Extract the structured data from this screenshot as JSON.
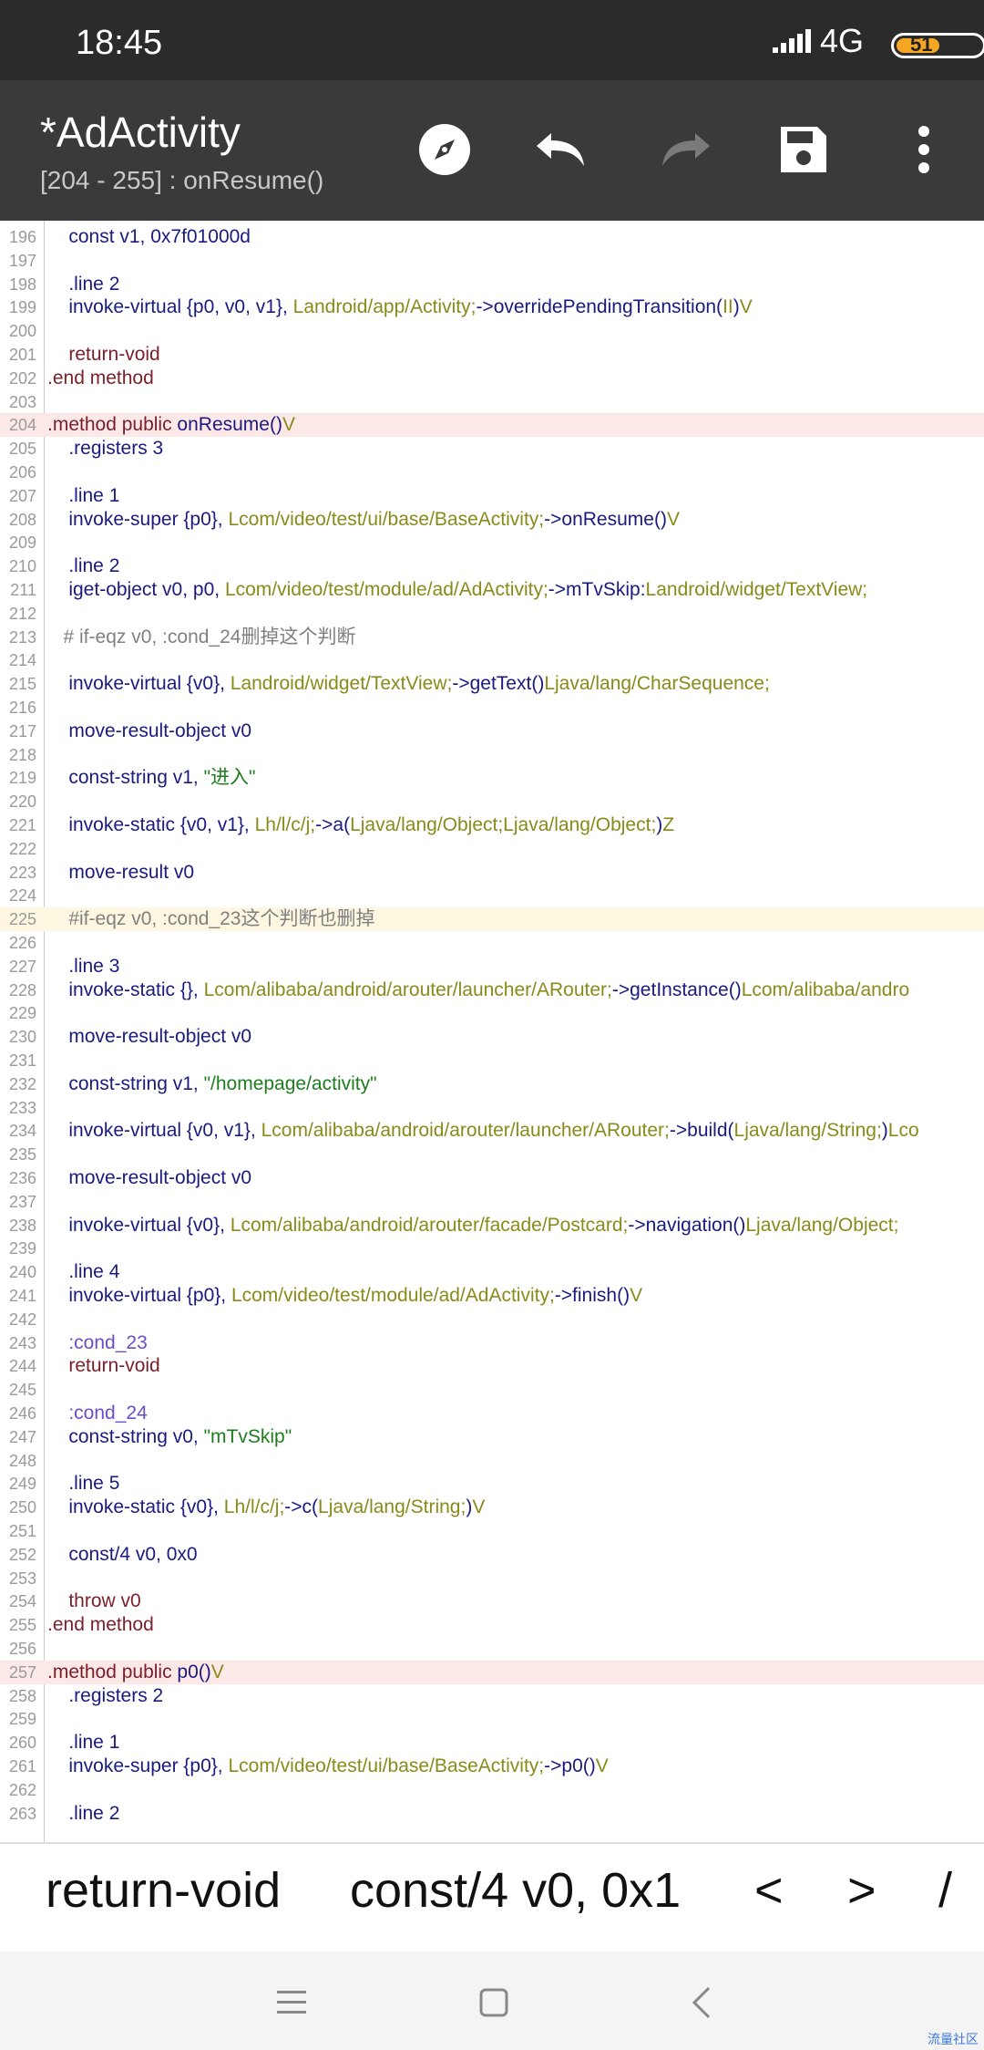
{
  "status_bar": {
    "time": "18:45",
    "network": "4G",
    "battery": "51",
    "battery_level": 0.51
  },
  "app_bar": {
    "title": "*AdActivity",
    "subtitle": "[204 - 255] : onResume()"
  },
  "editor": {
    "lines": [
      {
        "n": "196",
        "h": "",
        "parts": [
          [
            "",
            "    const v1, 0x7f01000d"
          ]
        ]
      },
      {
        "n": "197",
        "h": "",
        "parts": []
      },
      {
        "n": "198",
        "h": "",
        "parts": [
          [
            "",
            "    .line 2"
          ]
        ]
      },
      {
        "n": "199",
        "h": "",
        "parts": [
          [
            "",
            "    invoke-virtual {p0, v0, v1}, "
          ],
          [
            "ref",
            "Landroid/app/Activity;"
          ],
          [
            "",
            "->overridePendingTransition("
          ],
          [
            "ref",
            "II"
          ],
          [
            "",
            ")"
          ],
          [
            "ref",
            "V"
          ]
        ]
      },
      {
        "n": "200",
        "h": "",
        "parts": []
      },
      {
        "n": "201",
        "h": "",
        "parts": [
          [
            "kw",
            "    return-void"
          ]
        ]
      },
      {
        "n": "202",
        "h": "",
        "parts": [
          [
            "kw",
            ".end method"
          ]
        ]
      },
      {
        "n": "203",
        "h": "",
        "parts": []
      },
      {
        "n": "204",
        "h": "red",
        "parts": [
          [
            "kw",
            ".method public "
          ],
          [
            "",
            "onResume()"
          ],
          [
            "ref",
            "V"
          ]
        ]
      },
      {
        "n": "205",
        "h": "",
        "parts": [
          [
            "",
            "    .registers 3"
          ]
        ]
      },
      {
        "n": "206",
        "h": "",
        "parts": []
      },
      {
        "n": "207",
        "h": "",
        "parts": [
          [
            "",
            "    .line 1"
          ]
        ]
      },
      {
        "n": "208",
        "h": "",
        "parts": [
          [
            "",
            "    invoke-super {p0}, "
          ],
          [
            "ref",
            "Lcom/video/test/ui/base/BaseActivity;"
          ],
          [
            "",
            "->onResume()"
          ],
          [
            "ref",
            "V"
          ]
        ]
      },
      {
        "n": "209",
        "h": "",
        "parts": []
      },
      {
        "n": "210",
        "h": "",
        "parts": [
          [
            "",
            "    .line 2"
          ]
        ]
      },
      {
        "n": "211",
        "h": "",
        "parts": [
          [
            "",
            "    iget-object v0, p0, "
          ],
          [
            "ref",
            "Lcom/video/test/module/ad/AdActivity;"
          ],
          [
            "",
            "->mTvSkip:"
          ],
          [
            "ref",
            "Landroid/widget/TextView;"
          ]
        ]
      },
      {
        "n": "212",
        "h": "",
        "parts": []
      },
      {
        "n": "213",
        "h": "",
        "parts": [
          [
            "cm",
            "   # if-eqz v0, :cond_24删掉这个判断"
          ]
        ]
      },
      {
        "n": "214",
        "h": "",
        "parts": []
      },
      {
        "n": "215",
        "h": "",
        "parts": [
          [
            "",
            "    invoke-virtual {v0}, "
          ],
          [
            "ref",
            "Landroid/widget/TextView;"
          ],
          [
            "",
            "->getText()"
          ],
          [
            "ref",
            "Ljava/lang/CharSequence;"
          ]
        ]
      },
      {
        "n": "216",
        "h": "",
        "parts": []
      },
      {
        "n": "217",
        "h": "",
        "parts": [
          [
            "",
            "    move-result-object v0"
          ]
        ]
      },
      {
        "n": "218",
        "h": "",
        "parts": []
      },
      {
        "n": "219",
        "h": "",
        "parts": [
          [
            "",
            "    const-string v1, "
          ],
          [
            "str",
            "\"进入\""
          ]
        ]
      },
      {
        "n": "220",
        "h": "",
        "parts": []
      },
      {
        "n": "221",
        "h": "",
        "parts": [
          [
            "",
            "    invoke-static {v0, v1}, "
          ],
          [
            "ref",
            "Lh/l/c/j;"
          ],
          [
            "",
            "->a("
          ],
          [
            "ref",
            "Ljava/lang/Object;Ljava/lang/Object;"
          ],
          [
            "",
            ")"
          ],
          [
            "ref",
            "Z"
          ]
        ]
      },
      {
        "n": "222",
        "h": "",
        "parts": []
      },
      {
        "n": "223",
        "h": "",
        "parts": [
          [
            "",
            "    move-result v0"
          ]
        ]
      },
      {
        "n": "224",
        "h": "",
        "parts": []
      },
      {
        "n": "225",
        "h": "yellow",
        "parts": [
          [
            "cm",
            "    #if-eqz v0, :cond_23这个判断也删掉"
          ]
        ]
      },
      {
        "n": "226",
        "h": "",
        "parts": []
      },
      {
        "n": "227",
        "h": "",
        "parts": [
          [
            "",
            "    .line 3"
          ]
        ]
      },
      {
        "n": "228",
        "h": "",
        "parts": [
          [
            "",
            "    invoke-static {}, "
          ],
          [
            "ref",
            "Lcom/alibaba/android/arouter/launcher/ARouter;"
          ],
          [
            "",
            "->getInstance()"
          ],
          [
            "ref",
            "Lcom/alibaba/andro"
          ]
        ]
      },
      {
        "n": "229",
        "h": "",
        "parts": []
      },
      {
        "n": "230",
        "h": "",
        "parts": [
          [
            "",
            "    move-result-object v0"
          ]
        ]
      },
      {
        "n": "231",
        "h": "",
        "parts": []
      },
      {
        "n": "232",
        "h": "",
        "parts": [
          [
            "",
            "    const-string v1, "
          ],
          [
            "str",
            "\"/homepage/activity\""
          ]
        ]
      },
      {
        "n": "233",
        "h": "",
        "parts": []
      },
      {
        "n": "234",
        "h": "",
        "parts": [
          [
            "",
            "    invoke-virtual {v0, v1}, "
          ],
          [
            "ref",
            "Lcom/alibaba/android/arouter/launcher/ARouter;"
          ],
          [
            "",
            "->build("
          ],
          [
            "ref",
            "Ljava/lang/String;"
          ],
          [
            "",
            ")"
          ],
          [
            "ref",
            "Lco"
          ]
        ]
      },
      {
        "n": "235",
        "h": "",
        "parts": []
      },
      {
        "n": "236",
        "h": "",
        "parts": [
          [
            "",
            "    move-result-object v0"
          ]
        ]
      },
      {
        "n": "237",
        "h": "",
        "parts": []
      },
      {
        "n": "238",
        "h": "",
        "parts": [
          [
            "",
            "    invoke-virtual {v0}, "
          ],
          [
            "ref",
            "Lcom/alibaba/android/arouter/facade/Postcard;"
          ],
          [
            "",
            "->navigation()"
          ],
          [
            "ref",
            "Ljava/lang/Object;"
          ]
        ]
      },
      {
        "n": "239",
        "h": "",
        "parts": []
      },
      {
        "n": "240",
        "h": "",
        "parts": [
          [
            "",
            "    .line 4"
          ]
        ]
      },
      {
        "n": "241",
        "h": "",
        "parts": [
          [
            "",
            "    invoke-virtual {p0}, "
          ],
          [
            "ref",
            "Lcom/video/test/module/ad/AdActivity;"
          ],
          [
            "",
            "->finish()"
          ],
          [
            "ref",
            "V"
          ]
        ]
      },
      {
        "n": "242",
        "h": "",
        "parts": []
      },
      {
        "n": "243",
        "h": "",
        "parts": [
          [
            "lbl",
            "    :cond_23"
          ]
        ]
      },
      {
        "n": "244",
        "h": "",
        "parts": [
          [
            "kw",
            "    return-void"
          ]
        ]
      },
      {
        "n": "245",
        "h": "",
        "parts": []
      },
      {
        "n": "246",
        "h": "",
        "parts": [
          [
            "lbl",
            "    :cond_24"
          ]
        ]
      },
      {
        "n": "247",
        "h": "",
        "parts": [
          [
            "",
            "    const-string v0, "
          ],
          [
            "str",
            "\"mTvSkip\""
          ]
        ]
      },
      {
        "n": "248",
        "h": "",
        "parts": []
      },
      {
        "n": "249",
        "h": "",
        "parts": [
          [
            "",
            "    .line 5"
          ]
        ]
      },
      {
        "n": "250",
        "h": "",
        "parts": [
          [
            "",
            "    invoke-static {v0}, "
          ],
          [
            "ref",
            "Lh/l/c/j;"
          ],
          [
            "",
            "->c("
          ],
          [
            "ref",
            "Ljava/lang/String;"
          ],
          [
            "",
            ")"
          ],
          [
            "ref",
            "V"
          ]
        ]
      },
      {
        "n": "251",
        "h": "",
        "parts": []
      },
      {
        "n": "252",
        "h": "",
        "parts": [
          [
            "",
            "    const/4 v0, 0x0"
          ]
        ]
      },
      {
        "n": "253",
        "h": "",
        "parts": []
      },
      {
        "n": "254",
        "h": "",
        "parts": [
          [
            "kw",
            "    throw v0"
          ]
        ]
      },
      {
        "n": "255",
        "h": "",
        "parts": [
          [
            "kw",
            ".end method"
          ]
        ]
      },
      {
        "n": "256",
        "h": "",
        "parts": []
      },
      {
        "n": "257",
        "h": "red",
        "parts": [
          [
            "kw",
            ".method public "
          ],
          [
            "",
            "p0()"
          ],
          [
            "ref",
            "V"
          ]
        ]
      },
      {
        "n": "258",
        "h": "",
        "parts": [
          [
            "",
            "    .registers 2"
          ]
        ]
      },
      {
        "n": "259",
        "h": "",
        "parts": []
      },
      {
        "n": "260",
        "h": "",
        "parts": [
          [
            "",
            "    .line 1"
          ]
        ]
      },
      {
        "n": "261",
        "h": "",
        "parts": [
          [
            "",
            "    invoke-super {p0}, "
          ],
          [
            "ref",
            "Lcom/video/test/ui/base/BaseActivity;"
          ],
          [
            "",
            "->p0()"
          ],
          [
            "ref",
            "V"
          ]
        ]
      },
      {
        "n": "262",
        "h": "",
        "parts": []
      },
      {
        "n": "263",
        "h": "",
        "parts": [
          [
            "",
            "    .line 2"
          ]
        ]
      }
    ]
  },
  "shortcut_bar": {
    "items": [
      "return-void",
      "const/4 v0, 0x1",
      "<",
      ">",
      "/"
    ]
  },
  "watermark": "流量社区"
}
